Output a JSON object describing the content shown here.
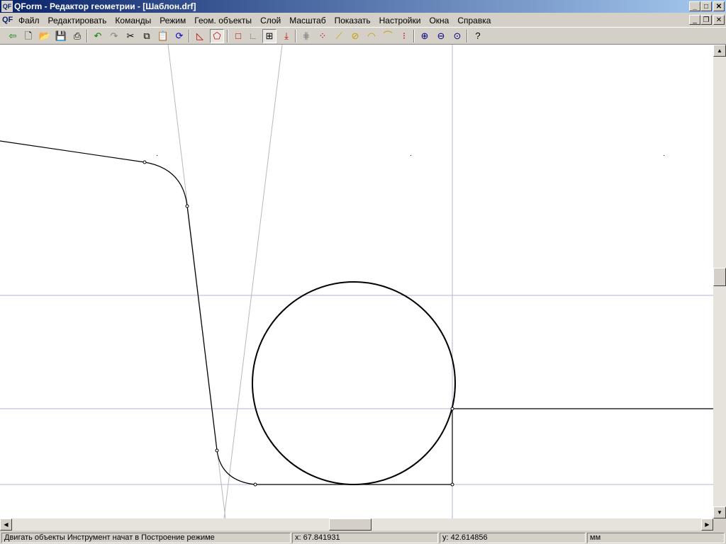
{
  "window": {
    "title": "QForm - Редактор геометрии - [Шаблон.drf]",
    "app_icon": "QF",
    "controls": [
      "_",
      "□",
      "✕"
    ]
  },
  "menu": {
    "items": [
      "Файл",
      "Редактировать",
      "Команды",
      "Режим",
      "Геом. объекты",
      "Слой",
      "Масштаб",
      "Показать",
      "Настройки",
      "Окна",
      "Справка"
    ],
    "mdi_controls": [
      "_",
      "❐",
      "✕"
    ]
  },
  "toolbar": {
    "buttons": [
      {
        "name": "exit-icon",
        "glyph": "⇦",
        "color": "#008000"
      },
      {
        "name": "new-file-icon",
        "glyph": "🗋",
        "color": "#000000"
      },
      {
        "name": "open-icon",
        "glyph": "📂",
        "color": "#c8a000"
      },
      {
        "name": "save-icon",
        "glyph": "💾",
        "color": "#000080"
      },
      {
        "name": "print-icon",
        "glyph": "⎙",
        "color": "#000000"
      },
      {
        "name": "undo-icon",
        "glyph": "↶",
        "color": "#008000"
      },
      {
        "name": "redo-icon",
        "glyph": "↷",
        "color": "#808080"
      },
      {
        "name": "cut-icon",
        "glyph": "✂",
        "color": "#000000"
      },
      {
        "name": "copy-icon",
        "glyph": "⧉",
        "color": "#000000"
      },
      {
        "name": "paste-icon",
        "glyph": "📋",
        "color": "#606060"
      },
      {
        "name": "refresh-icon",
        "glyph": "⟳",
        "color": "#0000c0"
      },
      {
        "name": "polyline-icon",
        "glyph": "◺",
        "color": "#c00000"
      },
      {
        "name": "shape-icon",
        "glyph": "⬠",
        "color": "#c00000"
      },
      {
        "name": "rectangle-icon",
        "glyph": "□",
        "color": "#c00000"
      },
      {
        "name": "corner-icon",
        "glyph": "∟",
        "color": "#808080"
      },
      {
        "name": "move-objects-icon",
        "glyph": "⊞",
        "color": "#000000"
      },
      {
        "name": "delete-icon",
        "glyph": "⤓",
        "color": "#c00000"
      },
      {
        "name": "trim-icon",
        "glyph": "⋕",
        "color": "#808080"
      },
      {
        "name": "points-icon",
        "glyph": "⁘",
        "color": "#c00000"
      },
      {
        "name": "line-icon",
        "glyph": "⟋",
        "color": "#c8a000"
      },
      {
        "name": "circle-icon",
        "glyph": "⊘",
        "color": "#c8a000"
      },
      {
        "name": "arc-icon",
        "glyph": "◠",
        "color": "#c8a000"
      },
      {
        "name": "fillet-icon",
        "glyph": "⌒",
        "color": "#c8a000"
      },
      {
        "name": "tangent-icon",
        "glyph": "⁝",
        "color": "#c00000"
      },
      {
        "name": "zoom-in-icon",
        "glyph": "⊕",
        "color": "#000080"
      },
      {
        "name": "zoom-out-icon",
        "glyph": "⊖",
        "color": "#000080"
      },
      {
        "name": "zoom-fit-icon",
        "glyph": "⊙",
        "color": "#000080"
      },
      {
        "name": "help-icon",
        "glyph": "?",
        "color": "#000000"
      }
    ]
  },
  "scroll": {
    "up": "▲",
    "down": "▼",
    "left": "◀",
    "right": "▶",
    "vertical_position": 0.49,
    "horizontal_position": 0.49
  },
  "status": {
    "message": "Двигать объекты Инструмент начат в Построение режиме",
    "x": "x: 67.841931",
    "y": "y: 42.614856",
    "units": "мм"
  }
}
